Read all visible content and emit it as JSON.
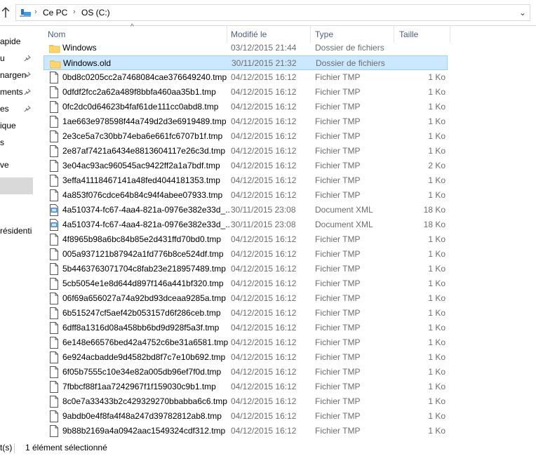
{
  "address": {
    "crumbs": [
      "Ce PC",
      "OS (C:)"
    ],
    "separator": "›",
    "dropdown": "⌄"
  },
  "nav": {
    "items": [
      {
        "label": "apide",
        "pinned": false
      },
      {
        "label": "u",
        "pinned": true
      },
      {
        "label": "nargen",
        "pinned": true
      },
      {
        "label": "ments",
        "pinned": true
      },
      {
        "label": "es",
        "pinned": true
      },
      {
        "label": "ique",
        "pinned": false
      },
      {
        "label": "s",
        "pinned": false
      },
      {
        "label": "ve",
        "pinned": false
      },
      {
        "label": "",
        "pinned": false
      },
      {
        "label": "",
        "pinned": false
      },
      {
        "label": "résidenti",
        "pinned": false
      }
    ]
  },
  "columns": {
    "name": "Nom",
    "modified": "Modifié le",
    "type": "Type",
    "size": "Taille",
    "sort_indicator": "^"
  },
  "files": [
    {
      "icon": "folder-icon",
      "name": "Windows",
      "date": "03/12/2015 21:44",
      "type": "Dossier de fichiers",
      "size": "",
      "selected": false
    },
    {
      "icon": "folder-icon",
      "name": "Windows.old",
      "date": "30/11/2015 21:32",
      "type": "Dossier de fichiers",
      "size": "",
      "selected": true
    },
    {
      "icon": "file-icon",
      "name": "0bd8c0205cc2a7468084cae376649240.tmp",
      "date": "04/12/2015 16:12",
      "type": "Fichier TMP",
      "size": "1 Ko",
      "selected": false
    },
    {
      "icon": "file-icon",
      "name": "0dfdf2fcc2a62a489f8bbfa460aa35b1.tmp",
      "date": "04/12/2015 16:12",
      "type": "Fichier TMP",
      "size": "1 Ko",
      "selected": false
    },
    {
      "icon": "file-icon",
      "name": "0fc2dc0d64623b4faf61de111cc0abd8.tmp",
      "date": "04/12/2015 16:12",
      "type": "Fichier TMP",
      "size": "1 Ko",
      "selected": false
    },
    {
      "icon": "file-icon",
      "name": "1ae663e978598f44a749d2d3e6919489.tmp",
      "date": "04/12/2015 16:12",
      "type": "Fichier TMP",
      "size": "1 Ko",
      "selected": false
    },
    {
      "icon": "file-icon",
      "name": "2e3ce5a7c30bb74eba6e661fc6707b1f.tmp",
      "date": "04/12/2015 16:12",
      "type": "Fichier TMP",
      "size": "1 Ko",
      "selected": false
    },
    {
      "icon": "file-icon",
      "name": "2e87af7421a6434e8813604117e26c3d.tmp",
      "date": "04/12/2015 16:12",
      "type": "Fichier TMP",
      "size": "1 Ko",
      "selected": false
    },
    {
      "icon": "file-icon",
      "name": "3e04ac93ac960545ac9422ff2a1a7bdf.tmp",
      "date": "04/12/2015 16:12",
      "type": "Fichier TMP",
      "size": "2 Ko",
      "selected": false
    },
    {
      "icon": "file-icon",
      "name": "3effa41118467141a48fed4044181353.tmp",
      "date": "04/12/2015 16:12",
      "type": "Fichier TMP",
      "size": "1 Ko",
      "selected": false
    },
    {
      "icon": "file-icon",
      "name": "4a853f076cdce64b84c94f4abee07933.tmp",
      "date": "04/12/2015 16:12",
      "type": "Fichier TMP",
      "size": "1 Ko",
      "selected": false
    },
    {
      "icon": "xml-icon",
      "name": "4a510374-fc67-4aa4-821a-0976e382e33d_...",
      "date": "30/11/2015 23:08",
      "type": "Document XML",
      "size": "18 Ko",
      "selected": false
    },
    {
      "icon": "xml-icon",
      "name": "4a510374-fc67-4aa4-821a-0976e382e33d_...",
      "date": "30/11/2015 23:08",
      "type": "Document XML",
      "size": "18 Ko",
      "selected": false
    },
    {
      "icon": "file-icon",
      "name": "4f8965b98a6bc84b85e2d431ffd70bd0.tmp",
      "date": "04/12/2015 16:12",
      "type": "Fichier TMP",
      "size": "1 Ko",
      "selected": false
    },
    {
      "icon": "file-icon",
      "name": "005a937121b87942a1fd776b8ce524df.tmp",
      "date": "04/12/2015 16:12",
      "type": "Fichier TMP",
      "size": "1 Ko",
      "selected": false
    },
    {
      "icon": "file-icon",
      "name": "5b4463763071704c8fab23e218957489.tmp",
      "date": "04/12/2015 16:12",
      "type": "Fichier TMP",
      "size": "1 Ko",
      "selected": false
    },
    {
      "icon": "file-icon",
      "name": "5cb5054e1e8d644d897f146a441bf320.tmp",
      "date": "04/12/2015 16:12",
      "type": "Fichier TMP",
      "size": "1 Ko",
      "selected": false
    },
    {
      "icon": "file-icon",
      "name": "06f69a656027a74a92bd93dceaa9285a.tmp",
      "date": "04/12/2015 16:12",
      "type": "Fichier TMP",
      "size": "1 Ko",
      "selected": false
    },
    {
      "icon": "file-icon",
      "name": "6b515247cf5aef42b053157d6f286ceb.tmp",
      "date": "04/12/2015 16:12",
      "type": "Fichier TMP",
      "size": "1 Ko",
      "selected": false
    },
    {
      "icon": "file-icon",
      "name": "6dff8a1316d08a458bb6bd9d928f5a3f.tmp",
      "date": "04/12/2015 16:12",
      "type": "Fichier TMP",
      "size": "1 Ko",
      "selected": false
    },
    {
      "icon": "file-icon",
      "name": "6e148e66576bed42a4752c6be31a6581.tmp",
      "date": "04/12/2015 16:12",
      "type": "Fichier TMP",
      "size": "1 Ko",
      "selected": false
    },
    {
      "icon": "file-icon",
      "name": "6e924acbadde9d4582bd8f7c7e10b692.tmp",
      "date": "04/12/2015 16:12",
      "type": "Fichier TMP",
      "size": "1 Ko",
      "selected": false
    },
    {
      "icon": "file-icon",
      "name": "6f05b7555c10e34e82a005db96ef7f0d.tmp",
      "date": "04/12/2015 16:12",
      "type": "Fichier TMP",
      "size": "1 Ko",
      "selected": false
    },
    {
      "icon": "file-icon",
      "name": "7fbbcf88f1aa7242967f1f159030c9b1.tmp",
      "date": "04/12/2015 16:12",
      "type": "Fichier TMP",
      "size": "1 Ko",
      "selected": false
    },
    {
      "icon": "file-icon",
      "name": "8c0e7a33433b2c429329270bbabba6c6.tmp",
      "date": "04/12/2015 16:12",
      "type": "Fichier TMP",
      "size": "1 Ko",
      "selected": false
    },
    {
      "icon": "file-icon",
      "name": "9abdb0e4f8fa4f48a247d39782812ab8.tmp",
      "date": "04/12/2015 16:12",
      "type": "Fichier TMP",
      "size": "1 Ko",
      "selected": false
    },
    {
      "icon": "file-icon",
      "name": "9b88b2169a4a0942aac1549324cdf312.tmp",
      "date": "04/12/2015 16:12",
      "type": "Fichier TMP",
      "size": "1 Ko",
      "selected": false
    }
  ],
  "status": {
    "items_count": "t(s)",
    "selection": "1 élément sélectionné"
  },
  "colors": {
    "selected_bg": "#cce8ff",
    "selected_border": "#99d1ff",
    "header_text": "#4d6082",
    "folder": "#ffd76e"
  }
}
